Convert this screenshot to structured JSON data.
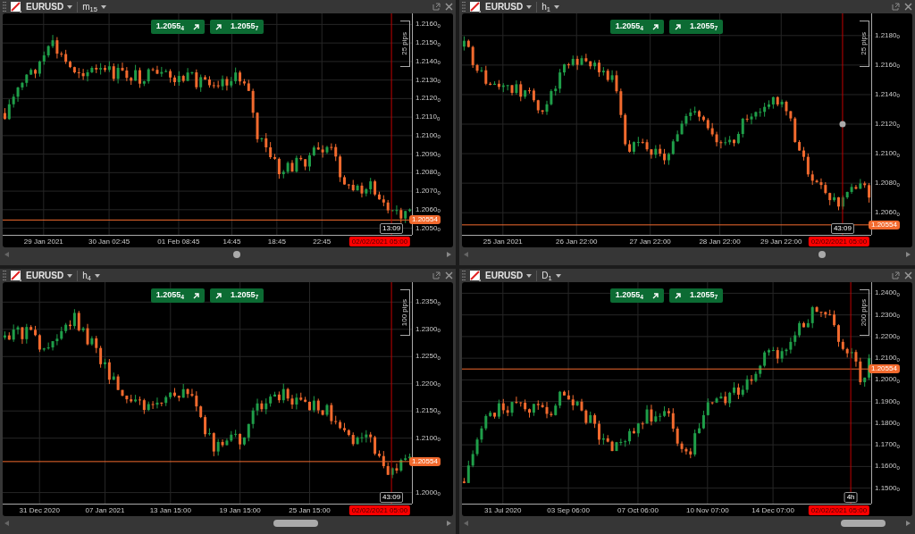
{
  "panels": [
    {
      "symbol": "EURUSD",
      "timeframe": "m$_{15}$",
      "bid": "1.2055$_{4}$",
      "ask": "1.2055$_{7}$",
      "pips": "25 pips",
      "price_axis": [
        "1.2160$_{0}$",
        "1.2150$_{0}$",
        "1.2140$_{0}$",
        "1.2130$_{0}$",
        "1.2120$_{0}$",
        "1.2110$_{0}$",
        "1.2100$_{0}$",
        "1.2090$_{0}$",
        "1.2080$_{0}$",
        "1.2070$_{0}$",
        "1.2060$_{0}$",
        "1.2050$_{0}$"
      ],
      "price_tag": "1.20554",
      "countdown": "13:09",
      "time_axis": [
        "29 Jan 2021",
        "30 Jan 02:45",
        "01 Feb 08:45",
        "14:45",
        "18:45",
        "22:45"
      ],
      "time_tag": "02/02/2021 05:00"
    },
    {
      "symbol": "EURUSD",
      "timeframe": "h$_{1}$",
      "bid": "1.2055$_{4}$",
      "ask": "1.2055$_{7}$",
      "pips": "25 pips",
      "price_axis": [
        "1.2180$_{0}$",
        "1.2160$_{0}$",
        "1.2140$_{0}$",
        "1.2120$_{0}$",
        "1.2100$_{0}$",
        "1.2080$_{0}$",
        "1.2060$_{0}$"
      ],
      "price_tag": "1.20554",
      "countdown": "43:09",
      "time_axis": [
        "25 Jan 2021",
        "26 Jan 22:00",
        "27 Jan 22:00",
        "28 Jan 22:00",
        "29 Jan 22:00"
      ],
      "time_tag": "02/02/2021 05:00"
    },
    {
      "symbol": "EURUSD",
      "timeframe": "h$_{4}$",
      "bid": "1.2055$_{4}$",
      "ask": "1.2055$_{7}$",
      "pips": "100 pips",
      "price_axis": [
        "1.2350$_{0}$",
        "1.2300$_{0}$",
        "1.2250$_{0}$",
        "1.2200$_{0}$",
        "1.2150$_{0}$",
        "1.2100$_{0}$",
        "1.2000$_{0}$"
      ],
      "price_tag": "1.20554",
      "countdown": "43:09",
      "time_axis": [
        "31 Dec 2020",
        "07 Jan 2021",
        "13 Jan 15:00",
        "19 Jan 15:00",
        "25 Jan 15:00"
      ],
      "time_tag": "02/02/2021 05:00"
    },
    {
      "symbol": "EURUSD",
      "timeframe": "D$_{1}$",
      "bid": "1.2055$_{4}$",
      "ask": "1.2055$_{7}$",
      "pips": "200 pips",
      "price_axis": [
        "1.2400$_{0}$",
        "1.2300$_{0}$",
        "1.2200$_{0}$",
        "1.2100$_{0}$",
        "1.2000$_{0}$",
        "1.1900$_{0}$",
        "1.1800$_{0}$",
        "1.1700$_{0}$",
        "1.1600$_{0}$",
        "1.1500$_{0}$"
      ],
      "price_tag": "1.20554",
      "countdown": "4h",
      "time_axis": [
        "31 Jul 2020",
        "03 Sep 06:00",
        "07 Oct 06:00",
        "10 Nov 07:00",
        "14 Dec 07:00"
      ],
      "time_tag": "02/02/2021 05:00"
    }
  ]
}
